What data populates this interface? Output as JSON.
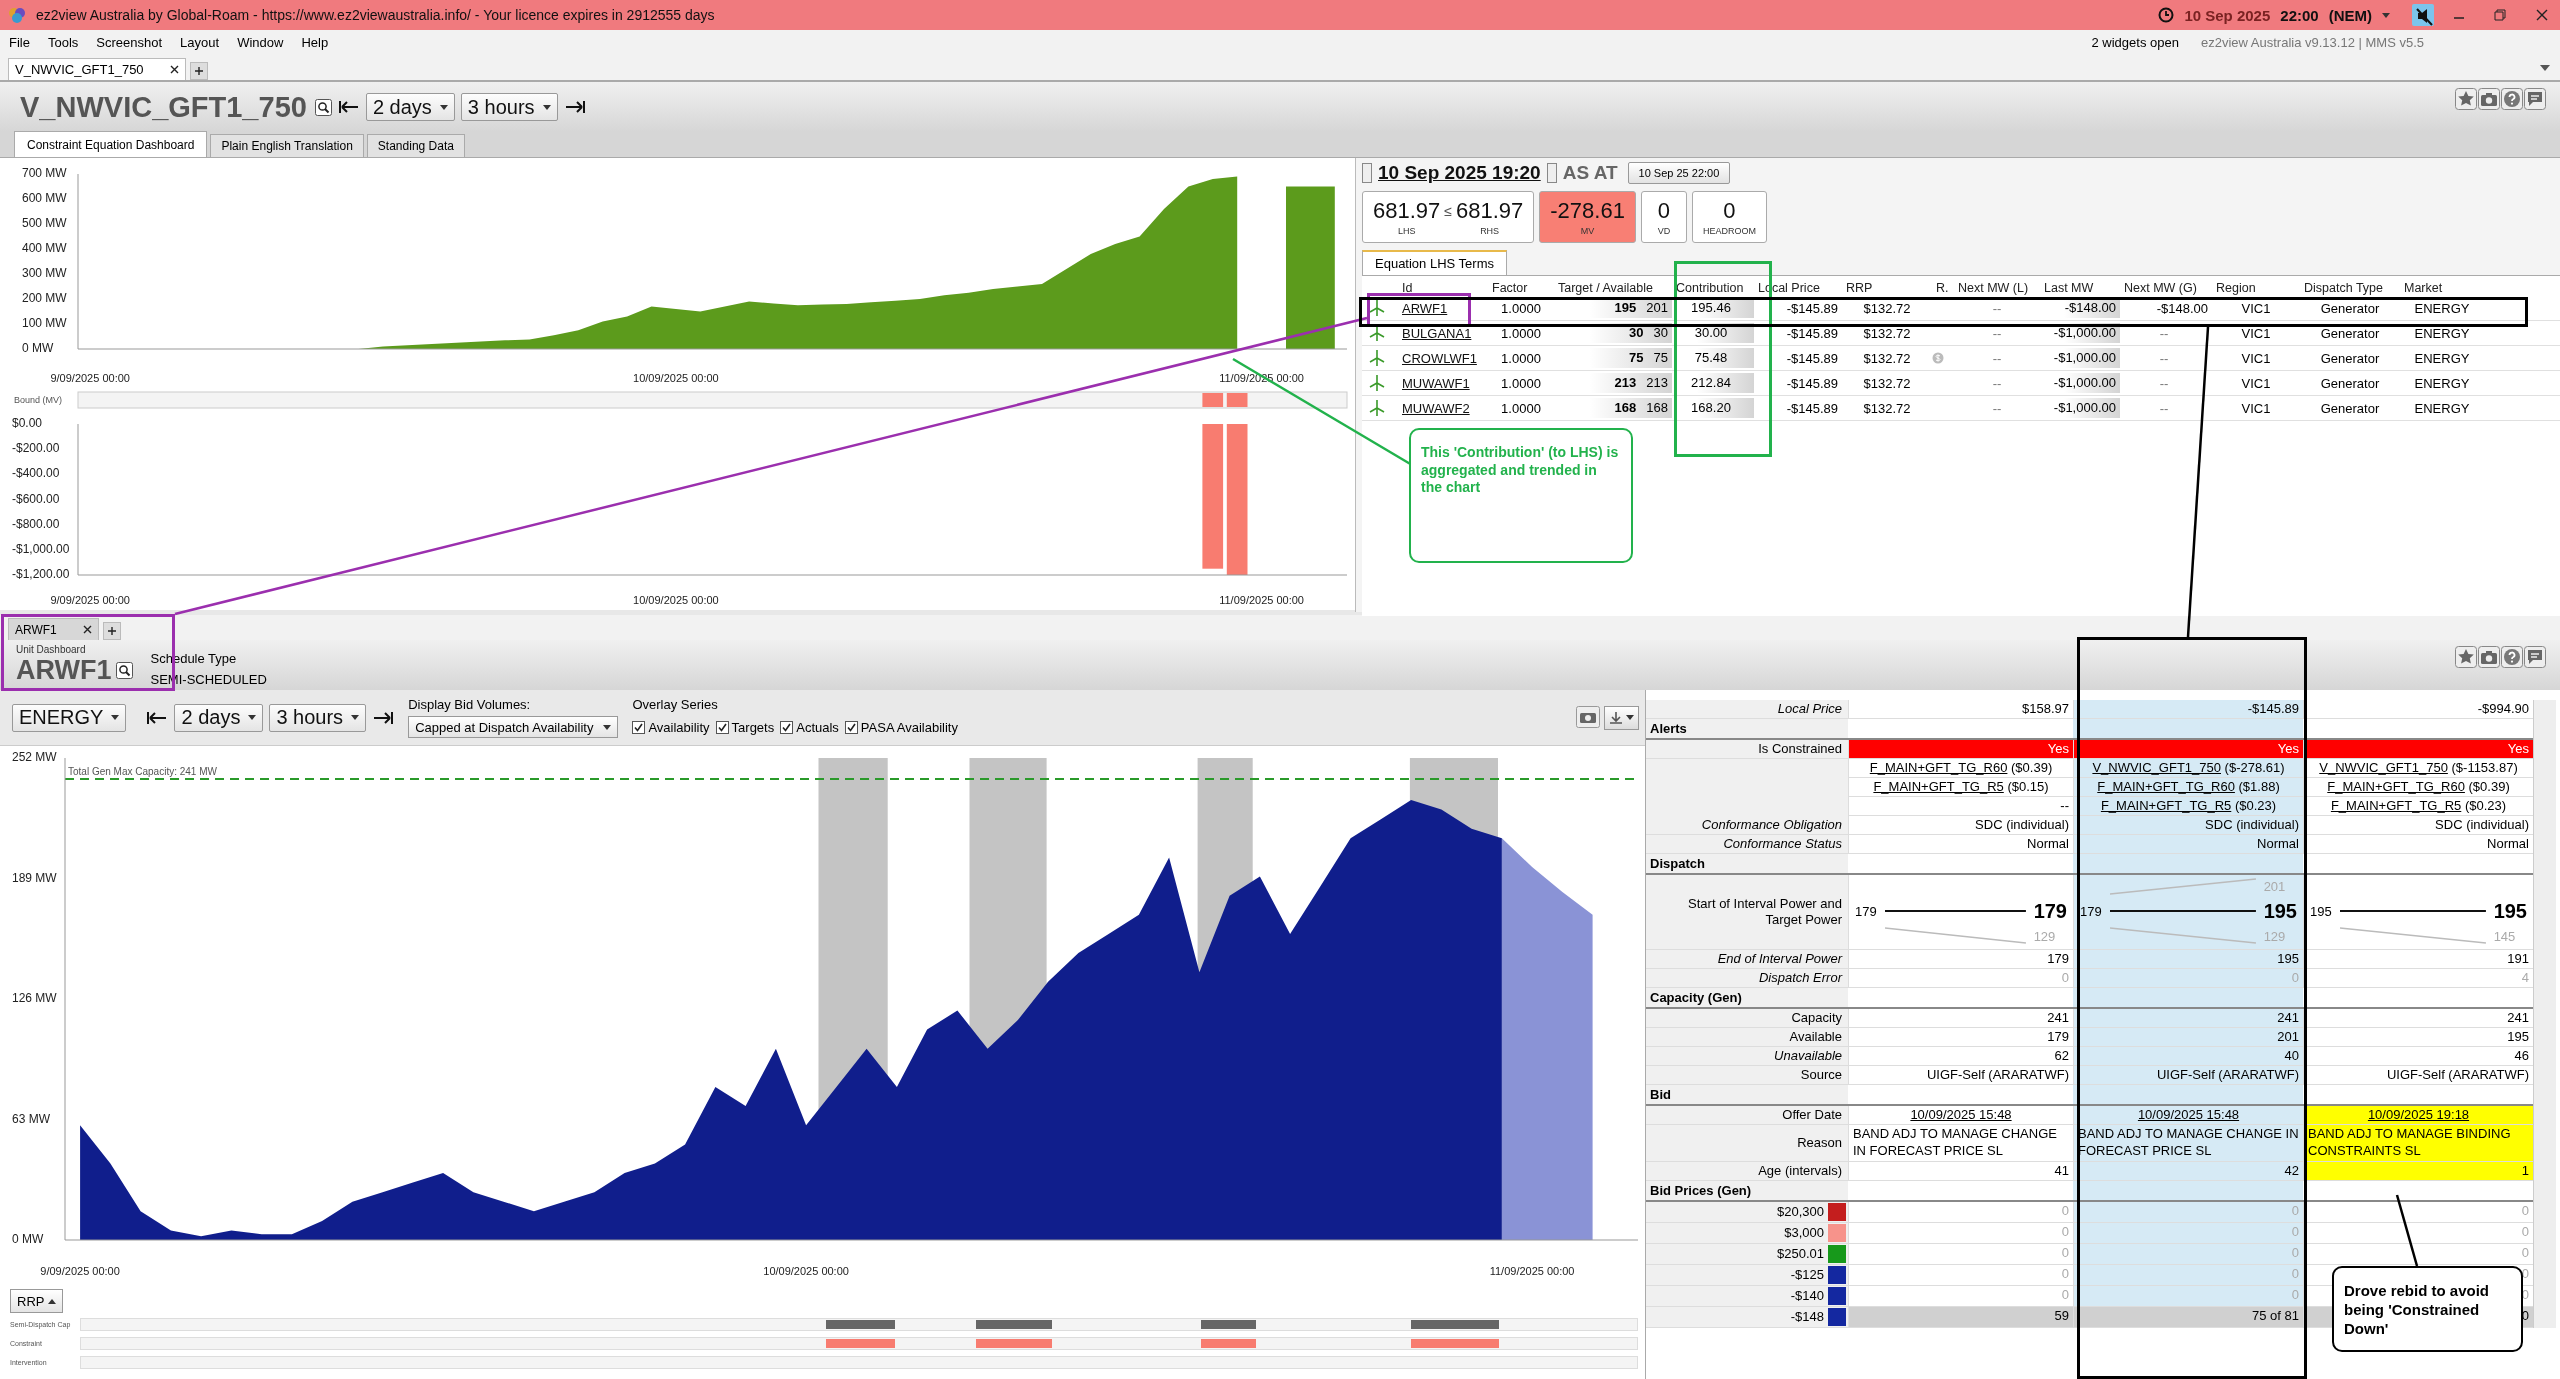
{
  "window": {
    "title": "ez2view Australia by Global-Roam - https://www.ez2viewaustralia.info/ - Your licence expires in 2912555 days",
    "date": "10 Sep 2025",
    "time": "22:00",
    "market": "(NEM)",
    "muted": true
  },
  "menu": [
    "File",
    "Tools",
    "Screenshot",
    "Layout",
    "Window",
    "Help"
  ],
  "status": {
    "widgets": "2 widgets open",
    "version": "ez2view Australia v9.13.12 | MMS v5.5"
  },
  "workspace_tabs": [
    {
      "label": "V_NWVIC_GFT1_750",
      "selected": true
    }
  ],
  "constraint_widget": {
    "title": "V_NWVIC_GFT1_750",
    "range": "2 days",
    "step": "3 hours",
    "tabs": [
      {
        "label": "Constraint Equation Dashboard",
        "selected": true
      },
      {
        "label": "Plain English Translation",
        "selected": false
      },
      {
        "label": "Standing Data",
        "selected": false
      }
    ],
    "lhs_chart": {
      "chart_data": {
        "type": "area",
        "categories": [
          "9/09/2025 00:00",
          null,
          null,
          null,
          null,
          null,
          null,
          null,
          null,
          null,
          null,
          null,
          null,
          null,
          null,
          null,
          null,
          null,
          null,
          null,
          null,
          null,
          null,
          null,
          "10/09/2025 00:00",
          null,
          null,
          null,
          null,
          null,
          null,
          null,
          null,
          null,
          null,
          null,
          null,
          null,
          null,
          null,
          null,
          null,
          null,
          null,
          null,
          null,
          null,
          null,
          "11/09/2025 00:00",
          null,
          null,
          null
        ],
        "series": [
          {
            "color": "#5c9b1c",
            "values": [
              0,
              0,
              0,
              0,
              0,
              0,
              0,
              0,
              0,
              0,
              0,
              0,
              10,
              15,
              20,
              25,
              30,
              35,
              38,
              55,
              75,
              110,
              130,
              170,
              160,
              150,
              170,
              190,
              182,
              175,
              178,
              180,
              187,
              193,
              200,
              215,
              225,
              240,
              250,
              260,
              320,
              380,
              420,
              450,
              560,
              650,
              680,
              690,
              null,
              650,
              650,
              650
            ]
          }
        ],
        "ylim": [
          0,
          700
        ],
        "yticks": [
          {
            "value": 0,
            "label": "0 MW"
          },
          {
            "value": 100,
            "label": "100 MW"
          },
          {
            "value": 200,
            "label": "200 MW"
          },
          {
            "value": 300,
            "label": "300 MW"
          },
          {
            "value": 400,
            "label": "400 MW"
          },
          {
            "value": 500,
            "label": "500 MW"
          },
          {
            "value": 600,
            "label": "600 MW"
          },
          {
            "value": 700,
            "label": "700 MW"
          }
        ]
      }
    },
    "mv_chart": {
      "label": "Bound (MV)",
      "chart_data": {
        "type": "bar",
        "categories": [
          "9/09/2025 00:00",
          null,
          null,
          null,
          null,
          null,
          null,
          null,
          null,
          null,
          null,
          null,
          null,
          null,
          null,
          null,
          null,
          null,
          null,
          null,
          null,
          null,
          null,
          null,
          "10/09/2025 00:00",
          null,
          null,
          null,
          null,
          null,
          null,
          null,
          null,
          null,
          null,
          null,
          null,
          null,
          null,
          null,
          null,
          null,
          null,
          null,
          null,
          null,
          null,
          null,
          "11/09/2025 00:00",
          null,
          null,
          null
        ],
        "values": [
          null,
          null,
          null,
          null,
          null,
          null,
          null,
          null,
          null,
          null,
          null,
          null,
          null,
          null,
          null,
          null,
          null,
          null,
          null,
          null,
          null,
          null,
          null,
          null,
          null,
          null,
          null,
          null,
          null,
          null,
          null,
          null,
          null,
          null,
          null,
          null,
          null,
          null,
          null,
          null,
          null,
          null,
          null,
          null,
          null,
          null,
          -1150,
          -1200,
          null,
          null,
          null,
          null
        ],
        "ylim": [
          -1200,
          0
        ],
        "yticks": [
          {
            "value": 0,
            "label": "$0.00"
          },
          {
            "value": -200,
            "label": "-$200.00"
          },
          {
            "value": -400,
            "label": "-$400.00"
          },
          {
            "value": -600,
            "label": "-$600.00"
          },
          {
            "value": -800,
            "label": "-$800.00"
          },
          {
            "value": -1000,
            "label": "-$1,000.00"
          },
          {
            "value": -1200,
            "label": "-$1,200.00"
          }
        ]
      }
    },
    "interval": "10 Sep 2025 19:20",
    "as_at_label": "AS AT",
    "as_at": "10 Sep 25 22:00",
    "metrics": [
      {
        "kind": "lhs_rhs",
        "lhs": "681.97",
        "op": "≤",
        "rhs": "681.97",
        "lhs_label": "LHS",
        "rhs_label": "RHS"
      },
      {
        "kind": "alert",
        "value": "-278.61",
        "label": "MV"
      },
      {
        "kind": "plain",
        "value": "0",
        "label": "VD"
      },
      {
        "kind": "plain",
        "value": "0",
        "label": "HEADROOM"
      }
    ],
    "terms_tab": "Equation LHS Terms",
    "columns": [
      "Id",
      "Factor",
      "Target / Available",
      "Contribution",
      "Local Price",
      "RRP",
      "R.",
      "Next MW (L)",
      "Last MW",
      "Next MW (G)",
      "Region",
      "Dispatch Type",
      "Market"
    ],
    "rows": [
      {
        "id": "ARWF1",
        "factor": "1.0000",
        "target": "195",
        "available": "201",
        "contribution": "195.46",
        "local_price": "-$145.89",
        "rrp": "$132.72",
        "price_flag": false,
        "next_mw_l": "--",
        "last_mw": "-$148.00",
        "next_mw_g": "-$148.00",
        "region": "VIC1",
        "dispatch_type": "Generator",
        "market": "ENERGY"
      },
      {
        "id": "BULGANA1",
        "factor": "1.0000",
        "target": "30",
        "available": "30",
        "contribution": "30.00",
        "local_price": "-$145.89",
        "rrp": "$132.72",
        "price_flag": false,
        "next_mw_l": "--",
        "last_mw": "-$1,000.00",
        "next_mw_g": "--",
        "region": "VIC1",
        "dispatch_type": "Generator",
        "market": "ENERGY"
      },
      {
        "id": "CROWLWF1",
        "factor": "1.0000",
        "target": "75",
        "available": "75",
        "contribution": "75.48",
        "local_price": "-$145.89",
        "rrp": "$132.72",
        "price_flag": true,
        "next_mw_l": "--",
        "last_mw": "-$1,000.00",
        "next_mw_g": "--",
        "region": "VIC1",
        "dispatch_type": "Generator",
        "market": "ENERGY"
      },
      {
        "id": "MUWAWF1",
        "factor": "1.0000",
        "target": "213",
        "available": "213",
        "contribution": "212.84",
        "local_price": "-$145.89",
        "rrp": "$132.72",
        "price_flag": false,
        "next_mw_l": "--",
        "last_mw": "-$1,000.00",
        "next_mw_g": "--",
        "region": "VIC1",
        "dispatch_type": "Generator",
        "market": "ENERGY"
      },
      {
        "id": "MUWAWF2",
        "factor": "1.0000",
        "target": "168",
        "available": "168",
        "contribution": "168.20",
        "local_price": "-$145.89",
        "rrp": "$132.72",
        "price_flag": false,
        "next_mw_l": "--",
        "last_mw": "-$1,000.00",
        "next_mw_g": "--",
        "region": "VIC1",
        "dispatch_type": "Generator",
        "market": "ENERGY"
      }
    ]
  },
  "unit_widget": {
    "tab": "ARWF1",
    "dashboard_label": "Unit Dashboard",
    "title": "ARWF1",
    "schedule_type_label": "Schedule Type",
    "schedule_type": "SEMI-SCHEDULED",
    "market": "ENERGY",
    "range": "2 days",
    "step": "3 hours",
    "bid_volumes_label": "Display Bid Volumes:",
    "bid_volumes": "Capped at Dispatch Availability",
    "overlay_label": "Overlay Series",
    "overlay_series": [
      {
        "label": "Availability",
        "checked": true
      },
      {
        "label": "Targets",
        "checked": true
      },
      {
        "label": "Actuals",
        "checked": true
      },
      {
        "label": "PASA Availability",
        "checked": true
      }
    ],
    "chart": {
      "chart_data": {
        "type": "area",
        "categories": [
          "9/09/2025 00:00",
          null,
          null,
          null,
          null,
          null,
          null,
          null,
          null,
          null,
          null,
          null,
          null,
          null,
          null,
          null,
          null,
          null,
          null,
          null,
          null,
          null,
          null,
          null,
          "10/09/2025 00:00",
          null,
          null,
          null,
          null,
          null,
          null,
          null,
          null,
          null,
          null,
          null,
          null,
          null,
          null,
          null,
          null,
          null,
          null,
          null,
          null,
          null,
          null,
          null,
          "11/09/2025 00:00",
          null,
          null,
          null
        ],
        "series": [
          {
            "color": "#101e8c",
            "values": [
              60,
              40,
              15,
              5,
              2,
              5,
              3,
              3,
              10,
              20,
              25,
              30,
              35,
              25,
              20,
              15,
              20,
              25,
              35,
              40,
              50,
              80,
              70,
              100,
              60,
              80,
              100,
              80,
              110,
              120,
              100,
              115,
              135,
              150,
              160,
              170,
              200,
              140,
              180,
              190,
              160,
              185,
              210,
              220,
              230,
              225,
              215,
              210,
              null,
              null,
              null,
              null
            ]
          },
          {
            "color": "#8a93d6",
            "values": [
              null,
              null,
              null,
              null,
              null,
              null,
              null,
              null,
              null,
              null,
              null,
              null,
              null,
              null,
              null,
              null,
              null,
              null,
              null,
              null,
              null,
              null,
              null,
              null,
              null,
              null,
              null,
              null,
              null,
              null,
              null,
              null,
              null,
              null,
              null,
              null,
              null,
              null,
              null,
              null,
              null,
              null,
              null,
              null,
              null,
              null,
              null,
              210,
              195,
              182,
              170,
              null
            ]
          }
        ],
        "ylim": [
          0,
          252
        ],
        "yticks": [
          {
            "value": 0,
            "label": "0 MW"
          },
          {
            "value": 63,
            "label": "63 MW"
          },
          {
            "value": 126,
            "label": "126 MW"
          },
          {
            "value": 189,
            "label": "189 MW"
          },
          {
            "value": 252,
            "label": "252 MW"
          }
        ],
        "ref_lines": [
          {
            "axis": "y",
            "value": 241,
            "label": "Total Gen Max Capacity: 241 MW",
            "color": "#2a9a2a"
          }
        ]
      }
    },
    "rrp_button": "RRP",
    "tracks": [
      {
        "label": "Semi-Dispatch Cap",
        "kind": "cap"
      },
      {
        "label": "Constraint",
        "kind": "constraint"
      },
      {
        "label": "Intervention",
        "kind": "intervention"
      }
    ],
    "grid": {
      "columns": [
        {
          "selected": false
        },
        {
          "selected": true
        },
        {
          "selected": false
        }
      ],
      "rows": [
        {
          "kind": "value",
          "label": "Local Price",
          "italic": true,
          "values": [
            "$158.97",
            "-$145.89",
            "-$994.90"
          ]
        },
        {
          "kind": "section",
          "label": "Alerts"
        },
        {
          "kind": "alert",
          "label": "Is Constrained",
          "values": [
            "Yes",
            "Yes",
            "Yes"
          ]
        },
        {
          "kind": "links",
          "values": [
            {
              "link": "F_MAIN+GFT_TG_R60",
              "text": "($0.39)"
            },
            {
              "link": "V_NWVIC_GFT1_750",
              "text": "($-278.61)"
            },
            {
              "link": "V_NWVIC_GFT1_750",
              "text": "($-1153.87)"
            }
          ]
        },
        {
          "kind": "links",
          "values": [
            {
              "link": "F_MAIN+GFT_TG_R5",
              "text": "($0.15)"
            },
            {
              "link": "F_MAIN+GFT_TG_R60",
              "text": "($1.88)"
            },
            {
              "link": "F_MAIN+GFT_TG_R60",
              "text": "($0.39)"
            }
          ]
        },
        {
          "kind": "links",
          "values": [
            {
              "text": "--"
            },
            {
              "link": "F_MAIN+GFT_TG_R5",
              "text": "($0.23)"
            },
            {
              "link": "F_MAIN+GFT_TG_R5",
              "text": "($0.23)"
            }
          ]
        },
        {
          "kind": "value",
          "label": "Conformance Obligation",
          "italic": true,
          "values": [
            "SDC (individual)",
            "SDC (individual)",
            "SDC (individual)"
          ]
        },
        {
          "kind": "value",
          "label": "Conformance Status",
          "italic": true,
          "values": [
            "Normal",
            "Normal",
            "Normal"
          ]
        },
        {
          "kind": "section",
          "label": "Dispatch"
        },
        {
          "kind": "dispatch",
          "label": "Start of Interval Power and Target Power",
          "values": [
            {
              "start": "179",
              "target": "179",
              "lower": "129"
            },
            {
              "start": "179",
              "target": "195",
              "upper": "201",
              "lower": "129"
            },
            {
              "start": "195",
              "target": "195",
              "lower": "145"
            }
          ]
        },
        {
          "kind": "value",
          "label": "End of Interval Power",
          "italic": true,
          "values": [
            "179",
            "195",
            "191"
          ]
        },
        {
          "kind": "value",
          "label": "Dispatch Error",
          "italic": true,
          "dim": true,
          "values": [
            "0",
            "0",
            "4"
          ]
        },
        {
          "kind": "section",
          "label": "Capacity (Gen)"
        },
        {
          "kind": "value",
          "label": "Capacity",
          "values": [
            "241",
            "241",
            "241"
          ]
        },
        {
          "kind": "value",
          "label": "Available",
          "values": [
            "179",
            "201",
            "195"
          ]
        },
        {
          "kind": "value",
          "label": "Unavailable",
          "italic": true,
          "values": [
            "62",
            "40",
            "46"
          ]
        },
        {
          "kind": "value",
          "label": "Source",
          "values": [
            "UIGF-Self (ARARATWF)",
            "UIGF-Self (ARARATWF)",
            "UIGF-Self (ARARATWF)"
          ]
        },
        {
          "kind": "section",
          "label": "Bid"
        },
        {
          "kind": "offer",
          "label": "Offer Date",
          "values": [
            "10/09/2025 15:48",
            "10/09/2025 15:48",
            "10/09/2025 19:18"
          ],
          "highlighted": [
            false,
            false,
            true
          ]
        },
        {
          "kind": "reason",
          "label": "Reason",
          "values": [
            "BAND ADJ TO MANAGE CHANGE IN FORECAST PRICE SL",
            "BAND ADJ TO MANAGE CHANGE IN FORECAST PRICE SL",
            "BAND ADJ TO MANAGE BINDING CONSTRAINTS SL"
          ],
          "highlighted": [
            false,
            false,
            true
          ]
        },
        {
          "kind": "value",
          "label": "Age (intervals)",
          "values": [
            "41",
            "42",
            "1"
          ],
          "highlighted": [
            false,
            false,
            true
          ]
        },
        {
          "kind": "section",
          "label": "Bid Prices (Gen)"
        },
        {
          "kind": "bid",
          "label": "$20,300",
          "color": "#c41e1e",
          "dim": true,
          "values": [
            "0",
            "0",
            "0"
          ]
        },
        {
          "kind": "bid",
          "label": "$3,000",
          "color": "#f7938b",
          "dim": true,
          "values": [
            "0",
            "0",
            "0"
          ]
        },
        {
          "kind": "bid",
          "label": "$250.01",
          "color": "#17991b",
          "dim": true,
          "values": [
            "0",
            "0",
            "0"
          ]
        },
        {
          "kind": "bid",
          "label": "-$125",
          "color": "#1428a0",
          "dim": true,
          "values": [
            "0",
            "0",
            "0"
          ]
        },
        {
          "kind": "bid",
          "label": "-$140",
          "color": "#1428a0",
          "dim": true,
          "values": [
            "0",
            "0",
            "0"
          ]
        },
        {
          "kind": "bid",
          "label": "-$148",
          "color": "#1428a0",
          "dim": false,
          "values": [
            "59",
            "75 of 81",
            "0"
          ]
        }
      ]
    }
  },
  "annotations": [
    {
      "kind": "frame",
      "color": "#9b2fae"
    },
    {
      "kind": "frame",
      "color": "#9b2fae"
    },
    {
      "kind": "line",
      "color": "#9b2fae"
    },
    {
      "kind": "frame",
      "color": "#22b24c"
    },
    {
      "kind": "line",
      "color": "#22b24c"
    },
    {
      "kind": "note",
      "color": "#22b24c",
      "text": "This 'Contribution' (to LHS) is aggregated and trended in the chart"
    },
    {
      "kind": "frame",
      "color": "#000000"
    },
    {
      "kind": "line",
      "color": "#000000"
    },
    {
      "kind": "frame",
      "color": "#000000"
    },
    {
      "kind": "line",
      "color": "#000000"
    },
    {
      "kind": "note",
      "color": "#000000",
      "text": "Drove rebid to avoid being 'Constrained Down'"
    }
  ]
}
